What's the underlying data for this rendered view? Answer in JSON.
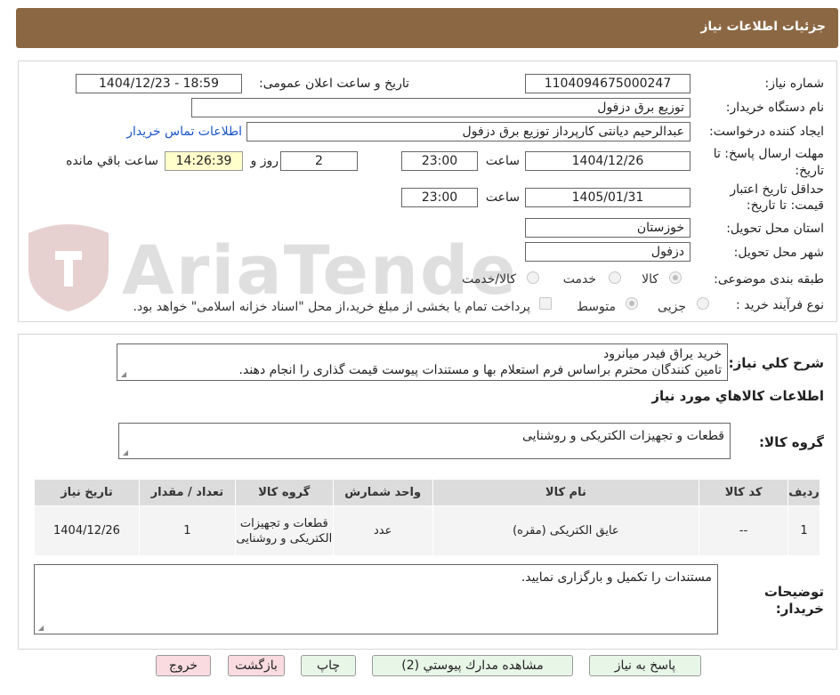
{
  "header": {
    "title": "جزئیات اطلاعات نیاز"
  },
  "form": {
    "need_number_label": "شماره نیاز:",
    "need_number": "1104094675000247",
    "announce_label": "تاریخ و ساعت اعلان عمومی:",
    "announce_value": "1404/12/23 - 18:59",
    "buyer_org_label": "نام دستگاه خریدار:",
    "buyer_org": "توزیع برق دزفول",
    "requester_label": "ایجاد کننده درخواست:",
    "requester": "عبدالرحیم دیانتی کارپرداز توزیع برق دزفول",
    "contact_link": "اطلاعات تماس خریدار",
    "deadline_label_1": "مهلت ارسال پاسخ: تا",
    "deadline_label_2": "تاریخ:",
    "deadline_date": "1404/12/26",
    "time_label": "ساعت",
    "deadline_time": "23:00",
    "days_value": "2",
    "days_label": "روز و",
    "remaining_time": "14:26:39",
    "remaining_label": "ساعت باقي مانده",
    "validity_label_1": "حداقل تاریخ اعتبار",
    "validity_label_2": "قیمت: تا تاریخ:",
    "validity_date": "1405/01/31",
    "validity_time_label": "ساعت",
    "validity_time": "23:00",
    "province_label": "استان محل تحویل:",
    "province": "خوزستان",
    "city_label": "شهر محل تحویل:",
    "city": "دزفول",
    "category_label": "طبقه بندی موضوعی:",
    "category_options": [
      "کالا",
      "خدمت",
      "کالا/خدمت"
    ],
    "process_label": "نوع فرآیند خرید :",
    "process_options": [
      "جزیی",
      "متوسط"
    ],
    "payment_note": "پرداخت تمام یا بخشی از مبلغ خرید،از محل \"اسناد خزانه اسلامی\" خواهد بود."
  },
  "watermark": {
    "text": "AriaTender.net"
  },
  "details": {
    "summary_label": "شرح کلي نياز:",
    "summary_line1": "خرید یراق فیدر میانرود",
    "summary_line2": "تامین کنندگان محترم براساس فرم استعلام بها و مستندات پیوست قیمت گذاری را انجام دهند.",
    "goods_info_title": "اطلاعات کالاهاي مورد نياز",
    "goods_group_label": "گروه کالا:",
    "goods_group": "قطعات و تجهیزات الکتریکی و روشنایی",
    "table": {
      "headers": [
        "رديف",
        "کد کالا",
        "نام کالا",
        "واحد شمارش",
        "گروه کالا",
        "تعداد / مقدار",
        "تاریخ نیاز"
      ],
      "rows": [
        [
          "1",
          "--",
          "عایق الکتریکی (مقره)",
          "عدد",
          "قطعات و تجهیزات الکتریکی و روشنایی",
          "1",
          "1404/12/26"
        ]
      ]
    },
    "buyer_notes_label_1": "توضیحات",
    "buyer_notes_label_2": "خریدار:",
    "buyer_notes": "مستندات را تکمیل و بارگزاری نمایید."
  },
  "buttons": {
    "reply": "پاسخ به نیاز",
    "attachments": "مشاهده مدارك پيوستي (2)",
    "print": "چاپ",
    "back": "بازگشت",
    "exit": "خروج"
  },
  "colors": {
    "header_bg": "#8b6843",
    "green_button": "#e8f6e8",
    "pink_button": "#f9dbe0",
    "link": "#1a56c9",
    "timer_bg": "#ffffcc"
  }
}
